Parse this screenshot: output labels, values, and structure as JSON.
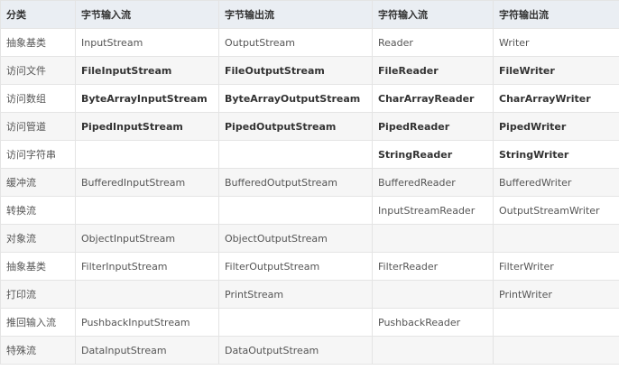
{
  "table": {
    "headers": [
      "分类",
      "字节输入流",
      "字节输出流",
      "字符输入流",
      "字符输出流"
    ],
    "rows": [
      {
        "cells": [
          "抽象基类",
          "InputStream",
          "OutputStream",
          "Reader",
          "Writer"
        ],
        "bold": false
      },
      {
        "cells": [
          "访问文件",
          "FileInputStream",
          "FileOutputStream",
          "FileReader",
          "FileWriter"
        ],
        "bold": true
      },
      {
        "cells": [
          "访问数组",
          "ByteArrayInputStream",
          "ByteArrayOutputStream",
          "CharArrayReader",
          "CharArrayWriter"
        ],
        "bold": true
      },
      {
        "cells": [
          "访问管道",
          "PipedInputStream",
          "PipedOutputStream",
          "PipedReader",
          "PipedWriter"
        ],
        "bold": true
      },
      {
        "cells": [
          "访问字符串",
          "",
          "",
          "StringReader",
          "StringWriter"
        ],
        "bold": true
      },
      {
        "cells": [
          "缓冲流",
          "BufferedInputStream",
          "BufferedOutputStream",
          "BufferedReader",
          "BufferedWriter"
        ],
        "bold": false
      },
      {
        "cells": [
          "转换流",
          "",
          "",
          "InputStreamReader",
          "OutputStreamWriter"
        ],
        "bold": false
      },
      {
        "cells": [
          "对象流",
          "ObjectInputStream",
          "ObjectOutputStream",
          "",
          ""
        ],
        "bold": false
      },
      {
        "cells": [
          "抽象基类",
          "FilterInputStream",
          "FilterOutputStream",
          "FilterReader",
          "FilterWriter"
        ],
        "bold": false
      },
      {
        "cells": [
          "打印流",
          "",
          "PrintStream",
          "",
          "PrintWriter"
        ],
        "bold": false
      },
      {
        "cells": [
          "推回输入流",
          "PushbackInputStream",
          "",
          "PushbackReader",
          ""
        ],
        "bold": false
      },
      {
        "cells": [
          "特殊流",
          "DataInputStream",
          "DataOutputStream",
          "",
          ""
        ],
        "bold": false
      }
    ]
  }
}
